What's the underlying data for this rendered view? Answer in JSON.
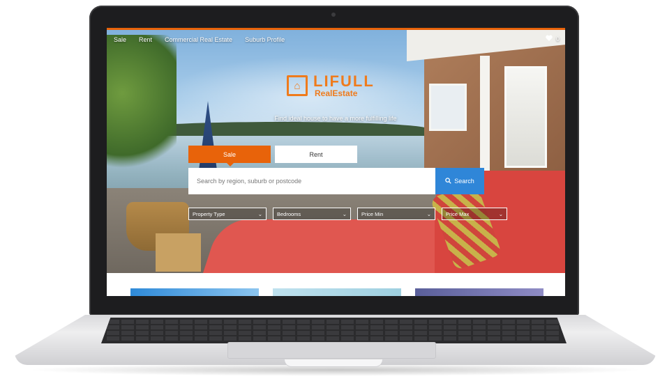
{
  "nav": {
    "items": [
      {
        "label": "Sale"
      },
      {
        "label": "Rent"
      },
      {
        "label": "Commercial Real Estate"
      },
      {
        "label": "Suburb Profile"
      }
    ],
    "favorites_icon": "heart-icon",
    "favorites_count": "0"
  },
  "brand": {
    "logo_icon": "house-bracket-icon",
    "name_top": "LIFULL",
    "name_bottom": "RealEstate",
    "tagline": "Find ideal house to have a more fulfilling life",
    "accent_color": "#e8630a"
  },
  "search": {
    "tabs": [
      {
        "label": "Sale",
        "active": true
      },
      {
        "label": "Rent",
        "active": false
      }
    ],
    "placeholder": "Search by region, suburb or postcode",
    "button_label": "Search",
    "button_icon": "search-icon",
    "button_color": "#2f86d8"
  },
  "filters": [
    {
      "label": "Property Type"
    },
    {
      "label": "Bedrooms"
    },
    {
      "label": "Price Min"
    },
    {
      "label": "Price Max"
    }
  ]
}
